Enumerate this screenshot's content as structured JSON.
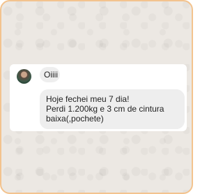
{
  "chat": {
    "messages": [
      {
        "text": "Oiiii"
      },
      {
        "lines": [
          "Hoje fechei meu 7 dia!",
          "Perdi 1.200kg e 3 cm de cintura",
          "baixa(,pochete)"
        ]
      }
    ]
  },
  "colors": {
    "frame_border": "#f3c38e",
    "chat_background": "#ece8e3",
    "card_background": "#ffffff",
    "bubble_background": "#eeeeee",
    "text": "#222222"
  }
}
